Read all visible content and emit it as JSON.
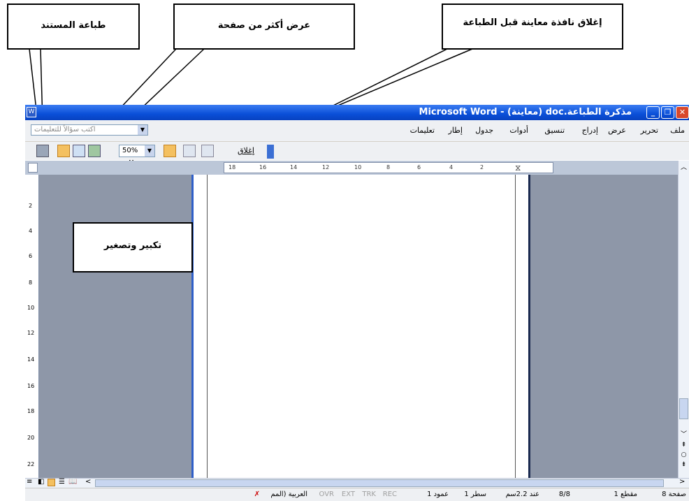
{
  "callouts": {
    "print": "طباعة المستند",
    "multi_page": "عرض أكثر من صفحة",
    "close_preview": "إغلاق نافذة معاينة قبل الطباعة",
    "zoom": "تكبير وتصغير"
  },
  "window": {
    "title": "مذكرة الطباعة.doc (معاينة) - Microsoft Word"
  },
  "menu": {
    "items": [
      "ملف",
      "تحرير",
      "عرض",
      "إدراج",
      "تنسيق",
      "أدوات",
      "جدول",
      "إطار",
      "تعليمات"
    ],
    "help_placeholder": "اكتب سؤالاً للتعليمات"
  },
  "toolbar": {
    "zoom_value": "50%",
    "close_label": "إغلاق"
  },
  "ruler": {
    "h_ticks": [
      "18",
      "16",
      "14",
      "12",
      "10",
      "8",
      "6",
      "4",
      "2"
    ],
    "v_ticks": [
      "2",
      "4",
      "6",
      "8",
      "10",
      "12",
      "14",
      "16",
      "18",
      "20",
      "22"
    ]
  },
  "statusbar": {
    "page": "صفحة 8",
    "section": "مقطع 1",
    "page_of": "8/8",
    "at": "عند 2.2سم",
    "line": "سطر 1",
    "column": "عمود 1",
    "rec": "REC",
    "trk": "TRK",
    "ext": "EXT",
    "ovr": "OVR",
    "language": "العربية (المم"
  },
  "colors": {
    "titlebar": "#0a4fd8",
    "gray_area": "#8e97a8",
    "menu_bg": "#eef0f3"
  }
}
